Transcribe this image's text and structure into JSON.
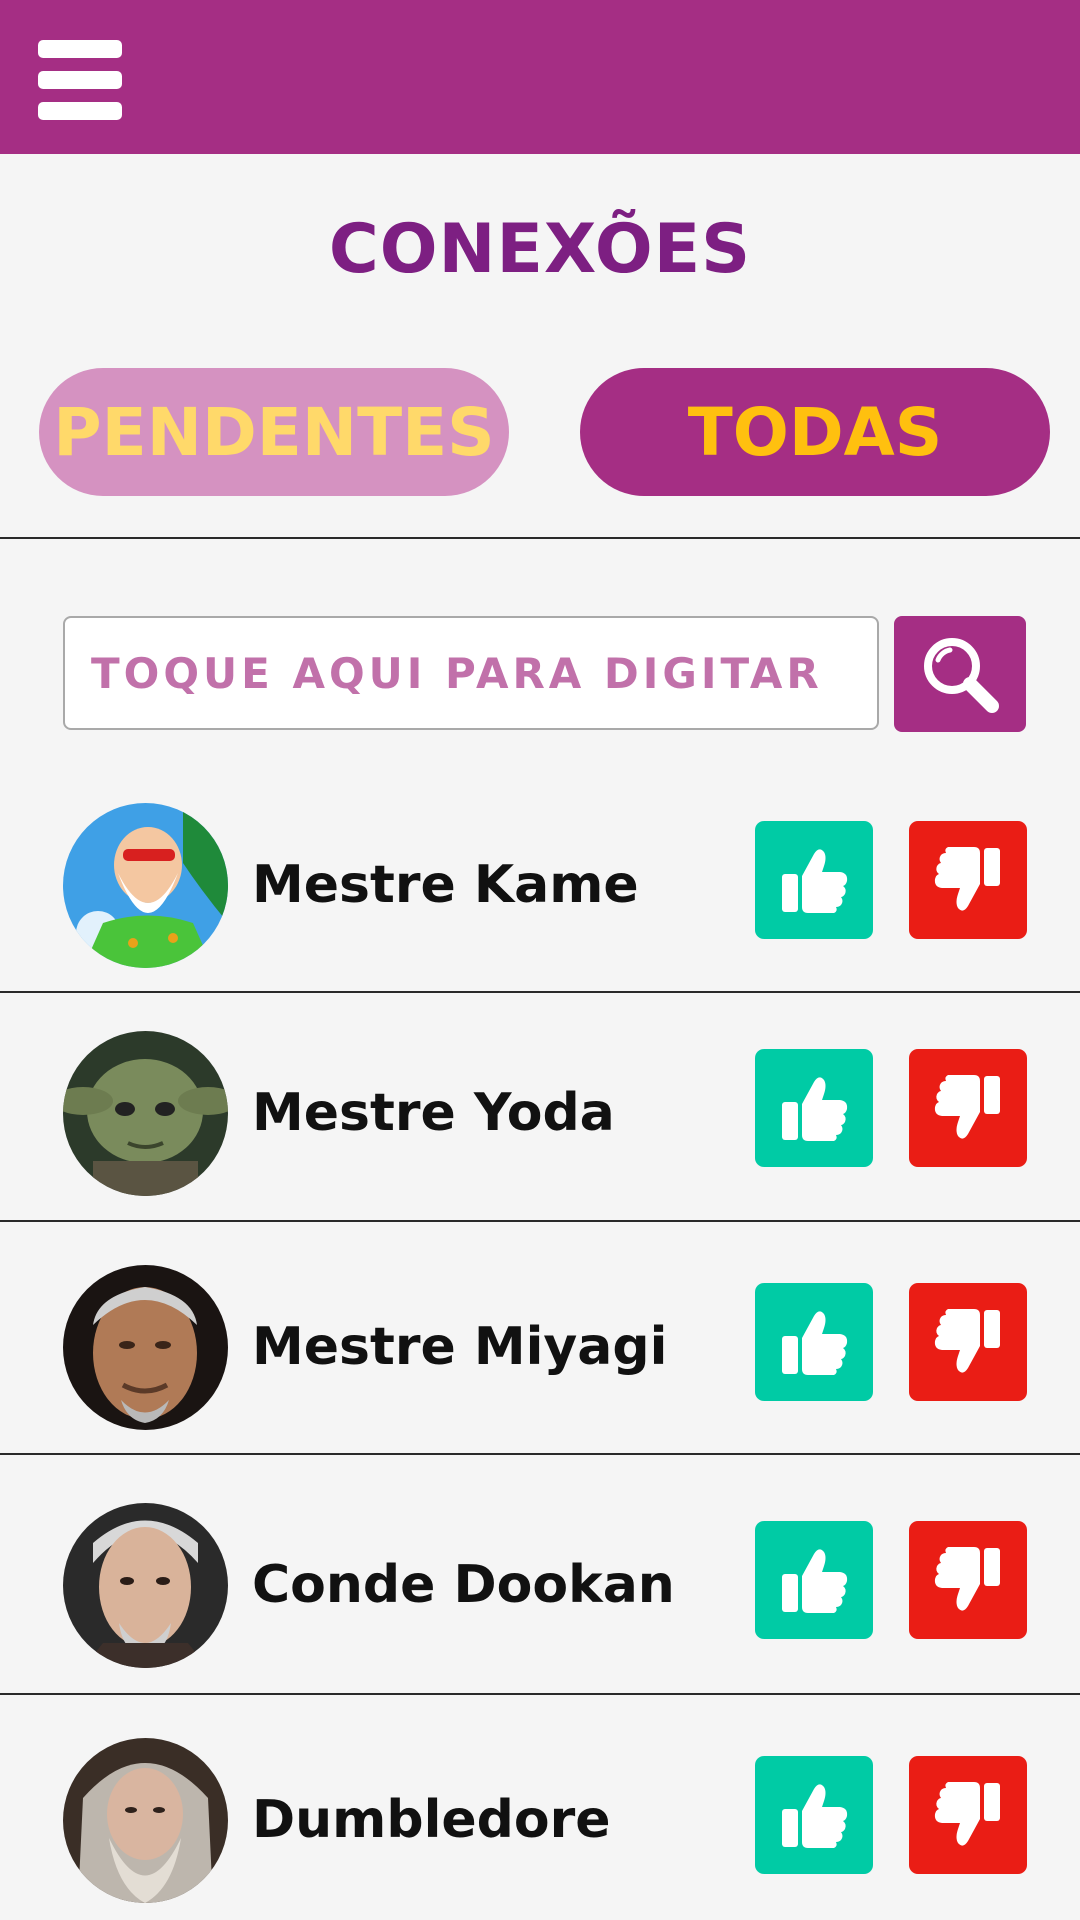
{
  "header": {
    "menu_icon": "hamburger-menu-icon",
    "bar_color": "#a52e84"
  },
  "page": {
    "title": "CONEXÕES",
    "title_color": "#7d1f82"
  },
  "tabs": [
    {
      "label": "PENDENTES",
      "selected": false
    },
    {
      "label": "TODAS",
      "selected": true
    }
  ],
  "search": {
    "placeholder": "TOQUE AQUI PARA DIGITAR",
    "value": "",
    "button_icon": "magnifier-icon"
  },
  "connections": [
    {
      "name": "Mestre Kame",
      "avatar": "avatar-photo"
    },
    {
      "name": "Mestre Yoda",
      "avatar": "avatar-photo"
    },
    {
      "name": "Mestre Miyagi",
      "avatar": "avatar-photo"
    },
    {
      "name": "Conde Dookan",
      "avatar": "avatar-photo"
    },
    {
      "name": "Dumbledore",
      "avatar": "avatar-photo"
    }
  ],
  "actions": {
    "accept_icon": "thumbs-up-icon",
    "reject_icon": "thumbs-down-icon",
    "accept_color": "#00cba5",
    "reject_color": "#ea1d15"
  }
}
